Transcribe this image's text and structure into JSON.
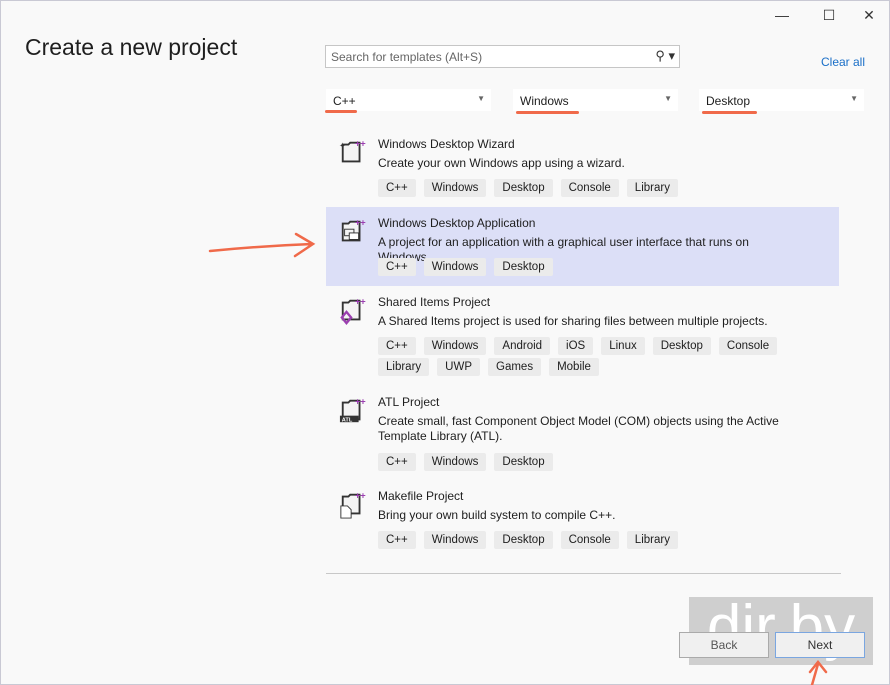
{
  "window": {
    "minimize": "—",
    "maximize": "☐",
    "close": "✕"
  },
  "title": "Create a new project",
  "search": {
    "placeholder": "Search for templates (Alt+S)"
  },
  "clear_all": "Clear all",
  "filters": {
    "language": "C++",
    "platform": "Windows",
    "project_type": "Desktop"
  },
  "templates": [
    {
      "name": "Windows Desktop Wizard",
      "desc": "Create your own Windows app using a wizard.",
      "tags": [
        "C++",
        "Windows",
        "Desktop",
        "Console",
        "Library"
      ],
      "selected": false
    },
    {
      "name": "Windows Desktop Application",
      "desc": "A project for an application with a graphical user interface that runs on Windows.",
      "tags": [
        "C++",
        "Windows",
        "Desktop"
      ],
      "selected": true
    },
    {
      "name": "Shared Items Project",
      "desc": "A Shared Items project is used for sharing files between multiple projects.",
      "tags": [
        "C++",
        "Windows",
        "Android",
        "iOS",
        "Linux",
        "Desktop",
        "Console",
        "Library",
        "UWP",
        "Games",
        "Mobile"
      ],
      "selected": false
    },
    {
      "name": "ATL Project",
      "desc": "Create small, fast Component Object Model (COM) objects using the Active Template Library (ATL).",
      "tags": [
        "C++",
        "Windows",
        "Desktop"
      ],
      "selected": false
    },
    {
      "name": "Makefile Project",
      "desc": "Bring your own build system to compile C++.",
      "tags": [
        "C++",
        "Windows",
        "Desktop",
        "Console",
        "Library"
      ],
      "selected": false
    }
  ],
  "buttons": {
    "back": "Back",
    "next": "Next"
  },
  "watermark": "dir.by",
  "colors": {
    "accent": "#f06a4a",
    "selected": "#dcdff7",
    "link": "#1a6fc8"
  }
}
